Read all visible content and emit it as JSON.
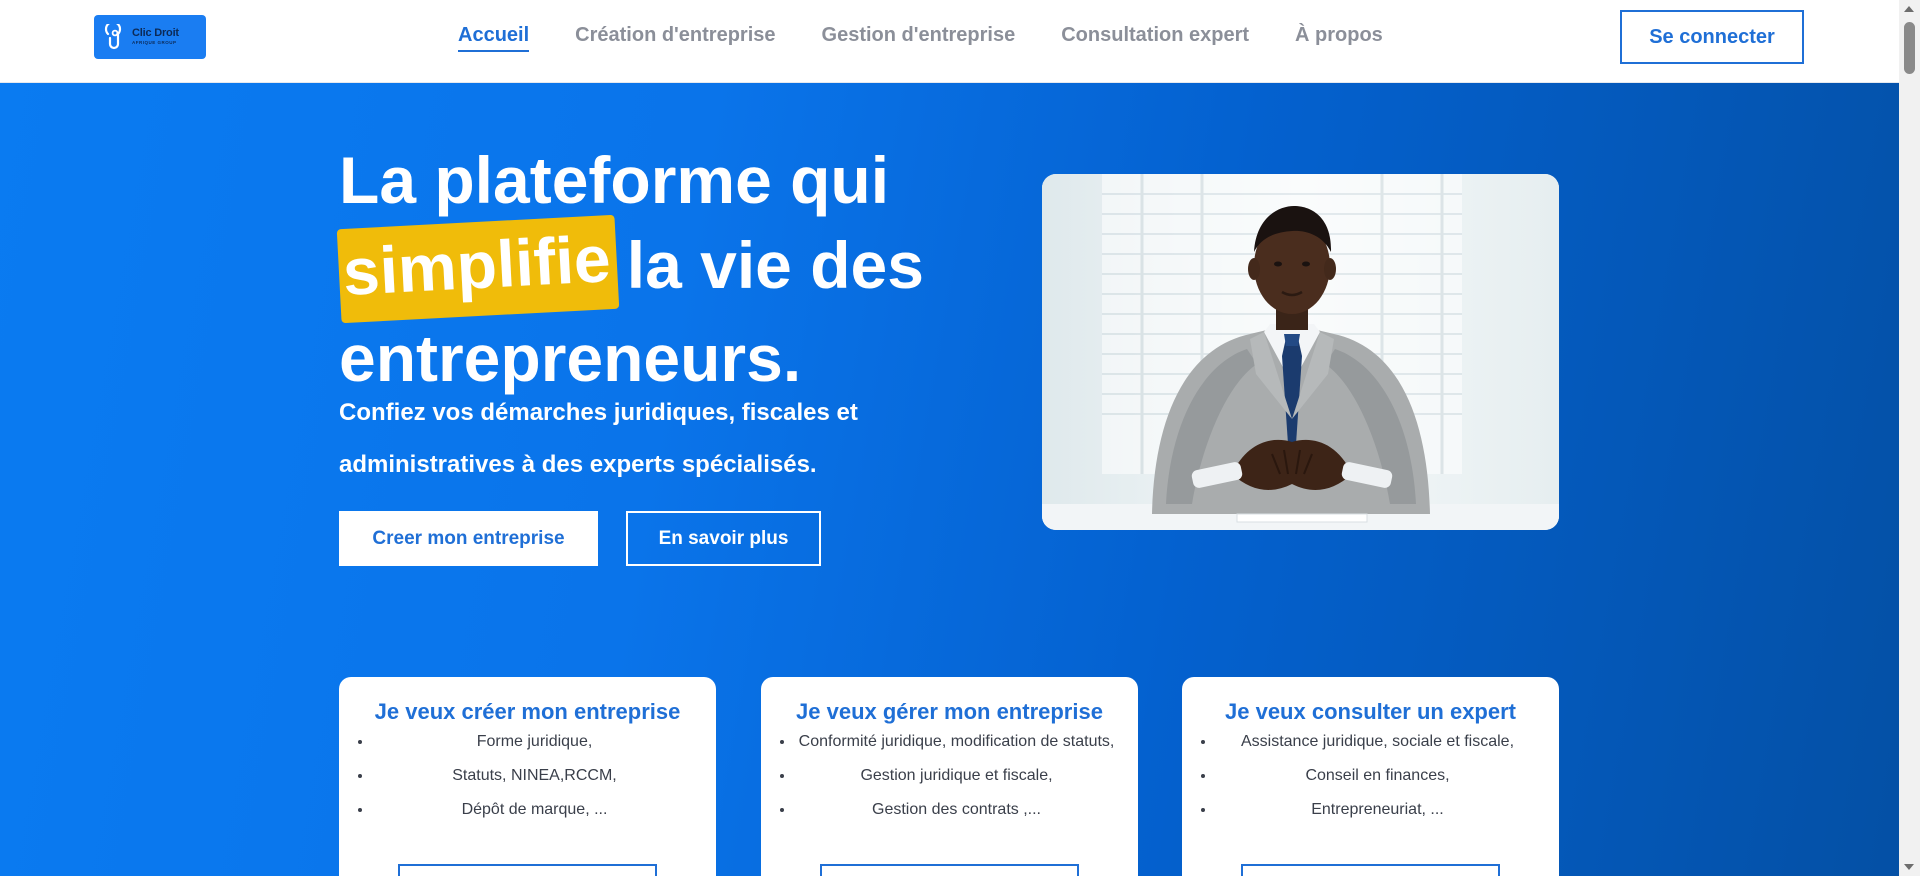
{
  "logo": {
    "name": "Clic Droit",
    "subtitle": "AFRIQUE GROUP"
  },
  "nav": {
    "items": [
      {
        "label": "Accueil",
        "active": true
      },
      {
        "label": "Création d'entreprise",
        "active": false
      },
      {
        "label": "Gestion d'entreprise",
        "active": false
      },
      {
        "label": "Consultation expert",
        "active": false
      },
      {
        "label": "À propos",
        "active": false
      }
    ],
    "login_label": "Se connecter"
  },
  "hero": {
    "title_line1": "La plateforme qui",
    "title_highlight": "simplifie",
    "title_line2_rest": "la vie des",
    "title_line3": "entrepreneurs.",
    "subtitle": "Confiez vos démarches juridiques, fiscales et administratives à des experts spécialisés.",
    "primary_button": "Creer mon entreprise",
    "secondary_button": "En savoir plus"
  },
  "cards": [
    {
      "title": "Je veux créer mon entreprise",
      "items": [
        "Forme juridique,",
        "Statuts, NINEA,RCCM,",
        "Dépôt de marque, ..."
      ]
    },
    {
      "title": "Je veux gérer mon entreprise",
      "items": [
        "Conformité juridique, modification de statuts,",
        "Gestion juridique et fiscale,",
        "Gestion des contrats ,..."
      ]
    },
    {
      "title": "Je veux consulter un expert",
      "items": [
        "Assistance juridique, sociale et fiscale,",
        "Conseil en finances,",
        "Entrepreneuriat, ..."
      ]
    }
  ],
  "colors": {
    "accent": "#1f6fd6",
    "highlight": "#f0bc0a",
    "hero_gradient_start": "#0a7bf1",
    "hero_gradient_end": "#0450a5"
  }
}
